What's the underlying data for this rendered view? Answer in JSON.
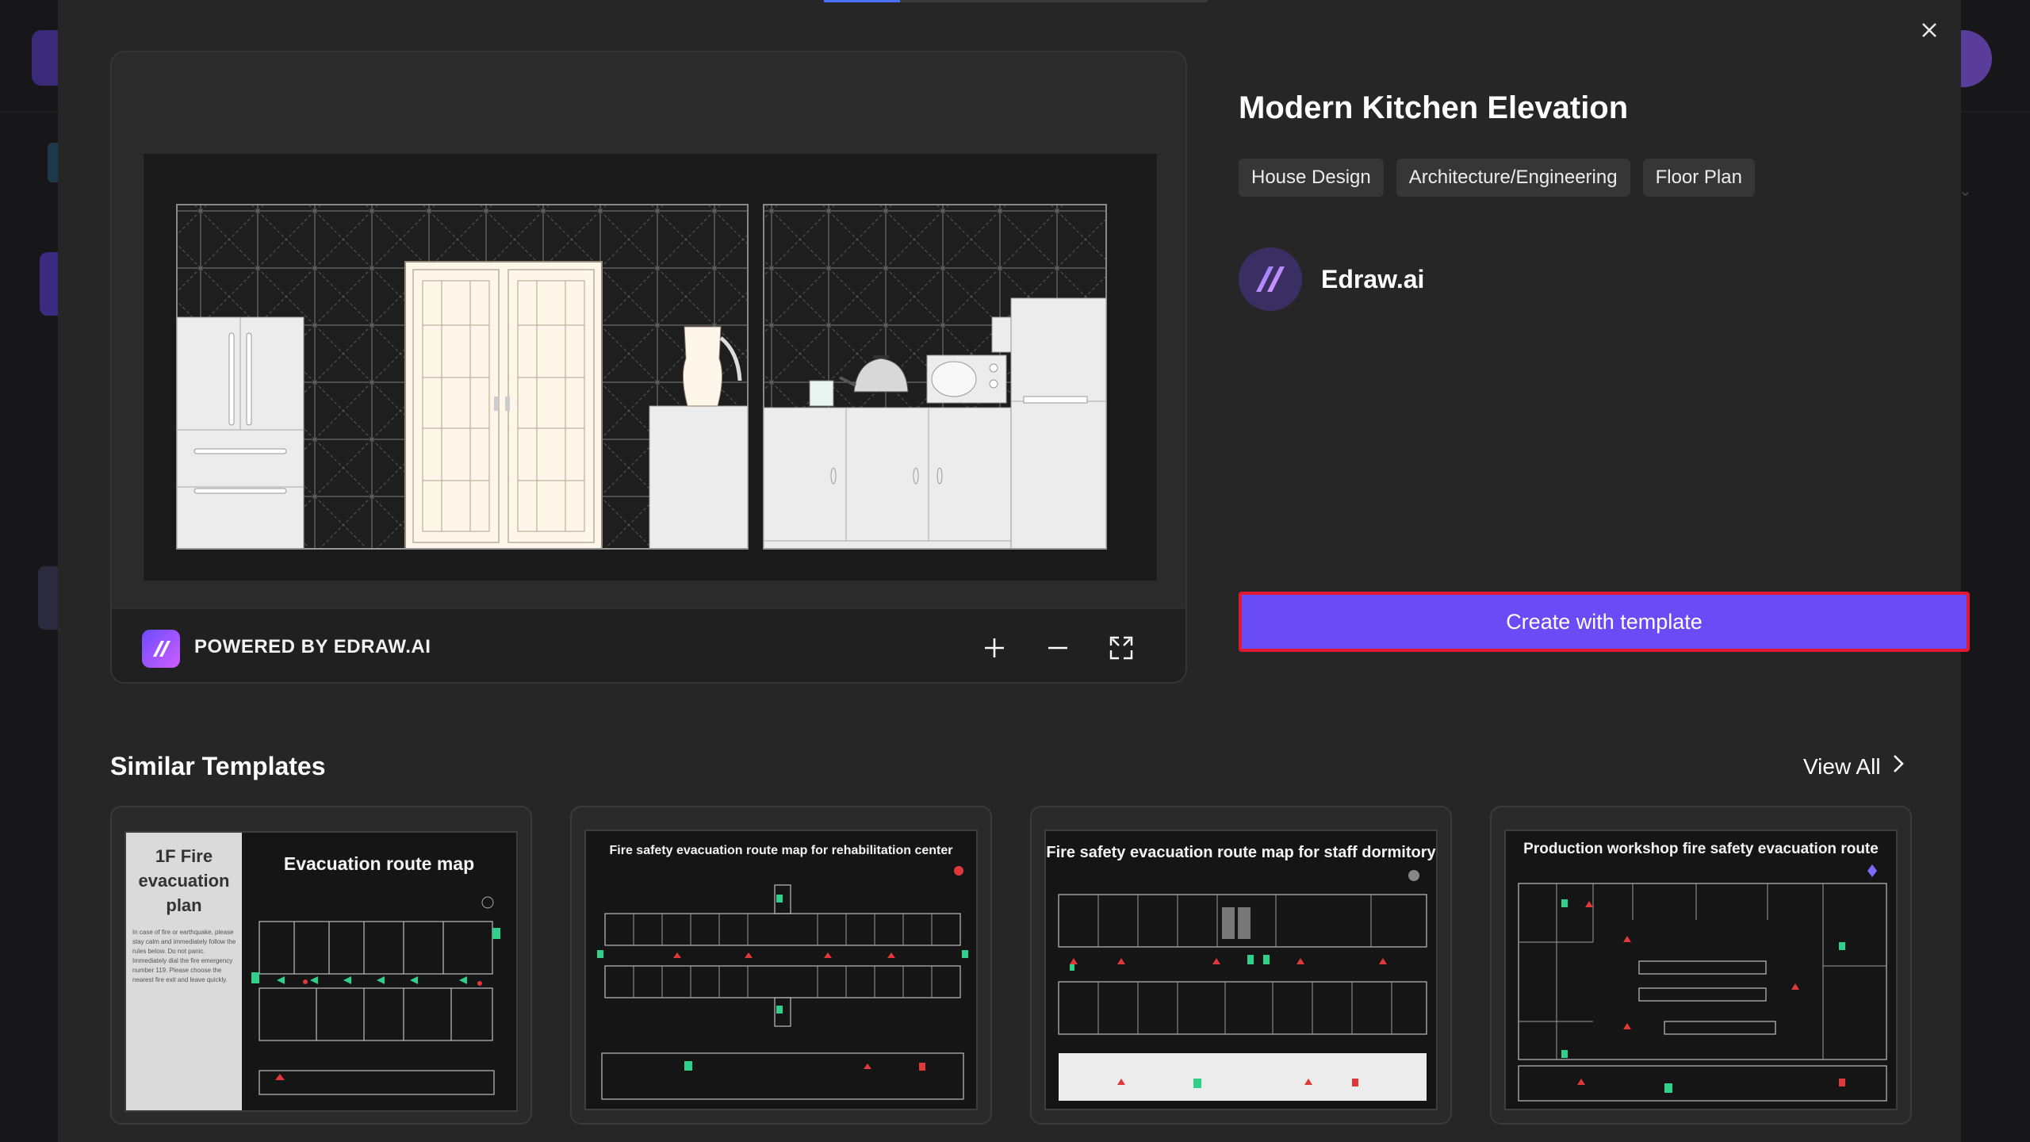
{
  "modal": {
    "close_icon": "close-icon",
    "template_title": "Modern Kitchen Elevation",
    "tags": [
      "House Design",
      "Architecture/Engineering",
      "Floor Plan"
    ],
    "author": {
      "name": "Edraw.ai",
      "avatar_icon": "edraw-logo-icon"
    },
    "create_button_label": "Create with template",
    "preview": {
      "powered_by": "POWERED BY EDRAW.AI",
      "zoom_in_icon": "plus-icon",
      "zoom_out_icon": "minus-icon",
      "fullscreen_icon": "fullscreen-icon"
    },
    "similar": {
      "heading": "Similar Templates",
      "view_all": "View All",
      "cards": [
        {
          "side_title": "1F Fire evacuation plan",
          "title": "Evacuation route map",
          "side_text": "In case of fire or earthquake, please stay calm and immediately follow the rules below. Do not panic. Immediately dial the fire emergency number 119. Please choose the nearest fire exit and leave quickly."
        },
        {
          "title": "Fire safety evacuation route map for rehabilitation center"
        },
        {
          "title": "Fire safety evacuation route map for staff dormitory"
        },
        {
          "title": "Production workshop fire safety evacuation route"
        }
      ]
    }
  }
}
